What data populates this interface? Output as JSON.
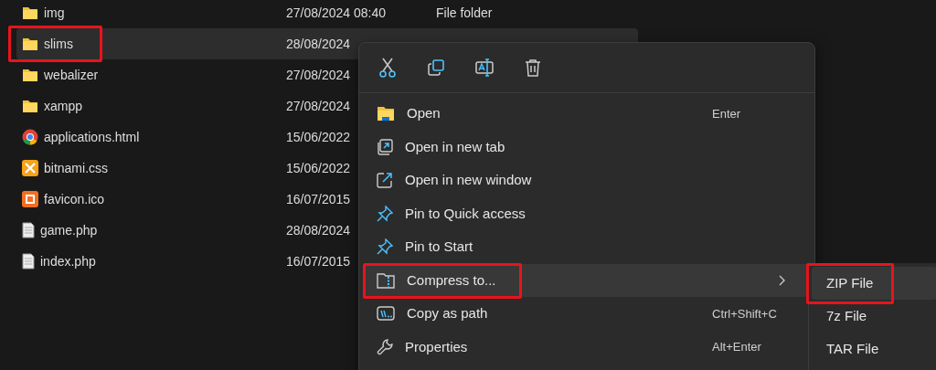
{
  "files": [
    {
      "name": "img",
      "kind": "folder",
      "date": "27/08/2024 08:40",
      "type": "File folder",
      "selected": false,
      "highlighted": false
    },
    {
      "name": "slims",
      "kind": "folder",
      "date": "28/08/2024",
      "selected": true,
      "highlighted": true
    },
    {
      "name": "webalizer",
      "kind": "folder",
      "date": "27/08/2024",
      "selected": false,
      "highlighted": false
    },
    {
      "name": "xampp",
      "kind": "folder",
      "date": "27/08/2024",
      "selected": false,
      "highlighted": false
    },
    {
      "name": "applications.html",
      "kind": "browser",
      "date": "15/06/2022",
      "selected": false,
      "highlighted": false
    },
    {
      "name": "bitnami.css",
      "kind": "tools",
      "date": "15/06/2022",
      "selected": false,
      "highlighted": false
    },
    {
      "name": "favicon.ico",
      "kind": "logo",
      "date": "16/07/2015",
      "selected": false,
      "highlighted": false
    },
    {
      "name": "game.php",
      "kind": "document",
      "date": "28/08/2024",
      "selected": false,
      "highlighted": false
    },
    {
      "name": "index.php",
      "kind": "document",
      "date": "16/07/2015",
      "selected": false,
      "highlighted": false
    }
  ],
  "context_menu": {
    "items": [
      {
        "label": "Open",
        "kind": "folder",
        "shortcut": "Enter",
        "selected": false,
        "highlighted": false
      },
      {
        "label": "Open in new tab",
        "kind": "tab",
        "selected": false,
        "highlighted": false
      },
      {
        "label": "Open in new window",
        "kind": "window",
        "selected": false,
        "highlighted": false
      },
      {
        "label": "Pin to Quick access",
        "kind": "pin",
        "selected": false,
        "highlighted": false
      },
      {
        "label": "Pin to Start",
        "kind": "pin",
        "selected": false,
        "highlighted": false
      },
      {
        "label": "Compress to...",
        "kind": "zip",
        "submenu": true,
        "selected": true,
        "highlighted": true
      },
      {
        "label": "Copy as path",
        "kind": "path",
        "shortcut": "Ctrl+Shift+C",
        "selected": false,
        "highlighted": false
      },
      {
        "label": "Properties",
        "kind": "wrench",
        "shortcut": "Alt+Enter",
        "selected": false,
        "highlighted": false
      }
    ]
  },
  "submenu": {
    "items": [
      {
        "label": "ZIP File",
        "selected": true,
        "highlighted": true
      },
      {
        "label": "7z File",
        "selected": false,
        "highlighted": false
      },
      {
        "label": "TAR File",
        "selected": false,
        "highlighted": false
      }
    ]
  }
}
